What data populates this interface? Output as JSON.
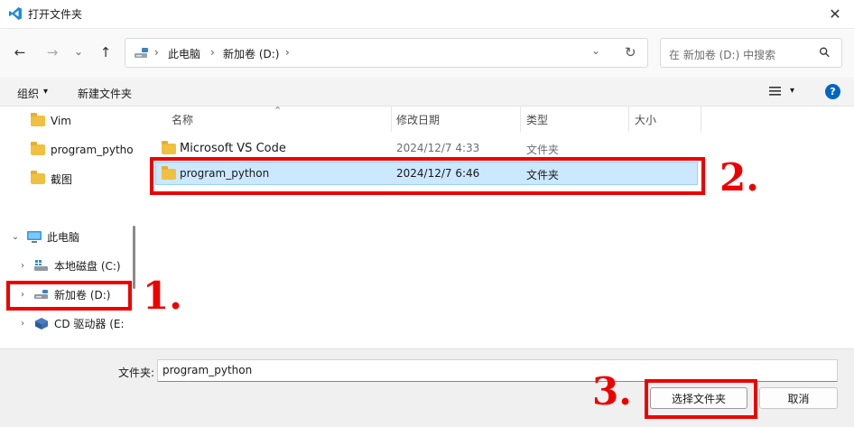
{
  "window": {
    "title": "打开文件夹",
    "close_symbol": "✕"
  },
  "nav": {
    "back": "←",
    "forward": "→",
    "recent": "⌄",
    "up": "↑"
  },
  "address": {
    "sep": "›",
    "crumbs": [
      "此电脑",
      "新加卷 (D:)"
    ],
    "dropdown": "⌄",
    "refresh": "↻"
  },
  "search": {
    "placeholder": "在 新加卷 (D:) 中搜索",
    "icon": "⚲"
  },
  "command_bar": {
    "organize": "组织",
    "organize_caret": "▾",
    "new_folder": "新建文件夹",
    "view_caret": "▾",
    "help": "?"
  },
  "sidebar": {
    "items": [
      {
        "label": "Vim",
        "icon": "folder-icon"
      },
      {
        "label": "program_pytho",
        "icon": "folder-icon"
      },
      {
        "label": "截图",
        "icon": "folder-icon"
      },
      {
        "label": "此电脑",
        "icon": "pc-icon",
        "expander": "⌄"
      },
      {
        "label": "本地磁盘 (C:)",
        "icon": "drive-icon",
        "expander": "›"
      },
      {
        "label": "新加卷 (D:)",
        "icon": "drive-icon",
        "expander": "›"
      },
      {
        "label": "CD 驱动器 (E:",
        "icon": "cd-icon",
        "expander": "›"
      }
    ]
  },
  "file_list": {
    "columns": [
      "名称",
      "修改日期",
      "类型",
      "大小"
    ],
    "sort_arrow": "⌃",
    "rows": [
      {
        "name": "Microsoft VS Code",
        "date": "2024/12/7 4:33",
        "type": "文件夹",
        "size": ""
      },
      {
        "name": "program_python",
        "date": "2024/12/7 6:46",
        "type": "文件夹",
        "size": ""
      }
    ]
  },
  "footer": {
    "folder_label": "文件夹:",
    "folder_value": "program_python",
    "select_button": "选择文件夹",
    "cancel_button": "取消"
  },
  "annotations": [
    "1.",
    "2.",
    "3."
  ],
  "colors": {
    "accent": "#0067c0",
    "selection": "#cce8ff",
    "annotation_red": "#ee0000",
    "folder": "#f0c040"
  }
}
